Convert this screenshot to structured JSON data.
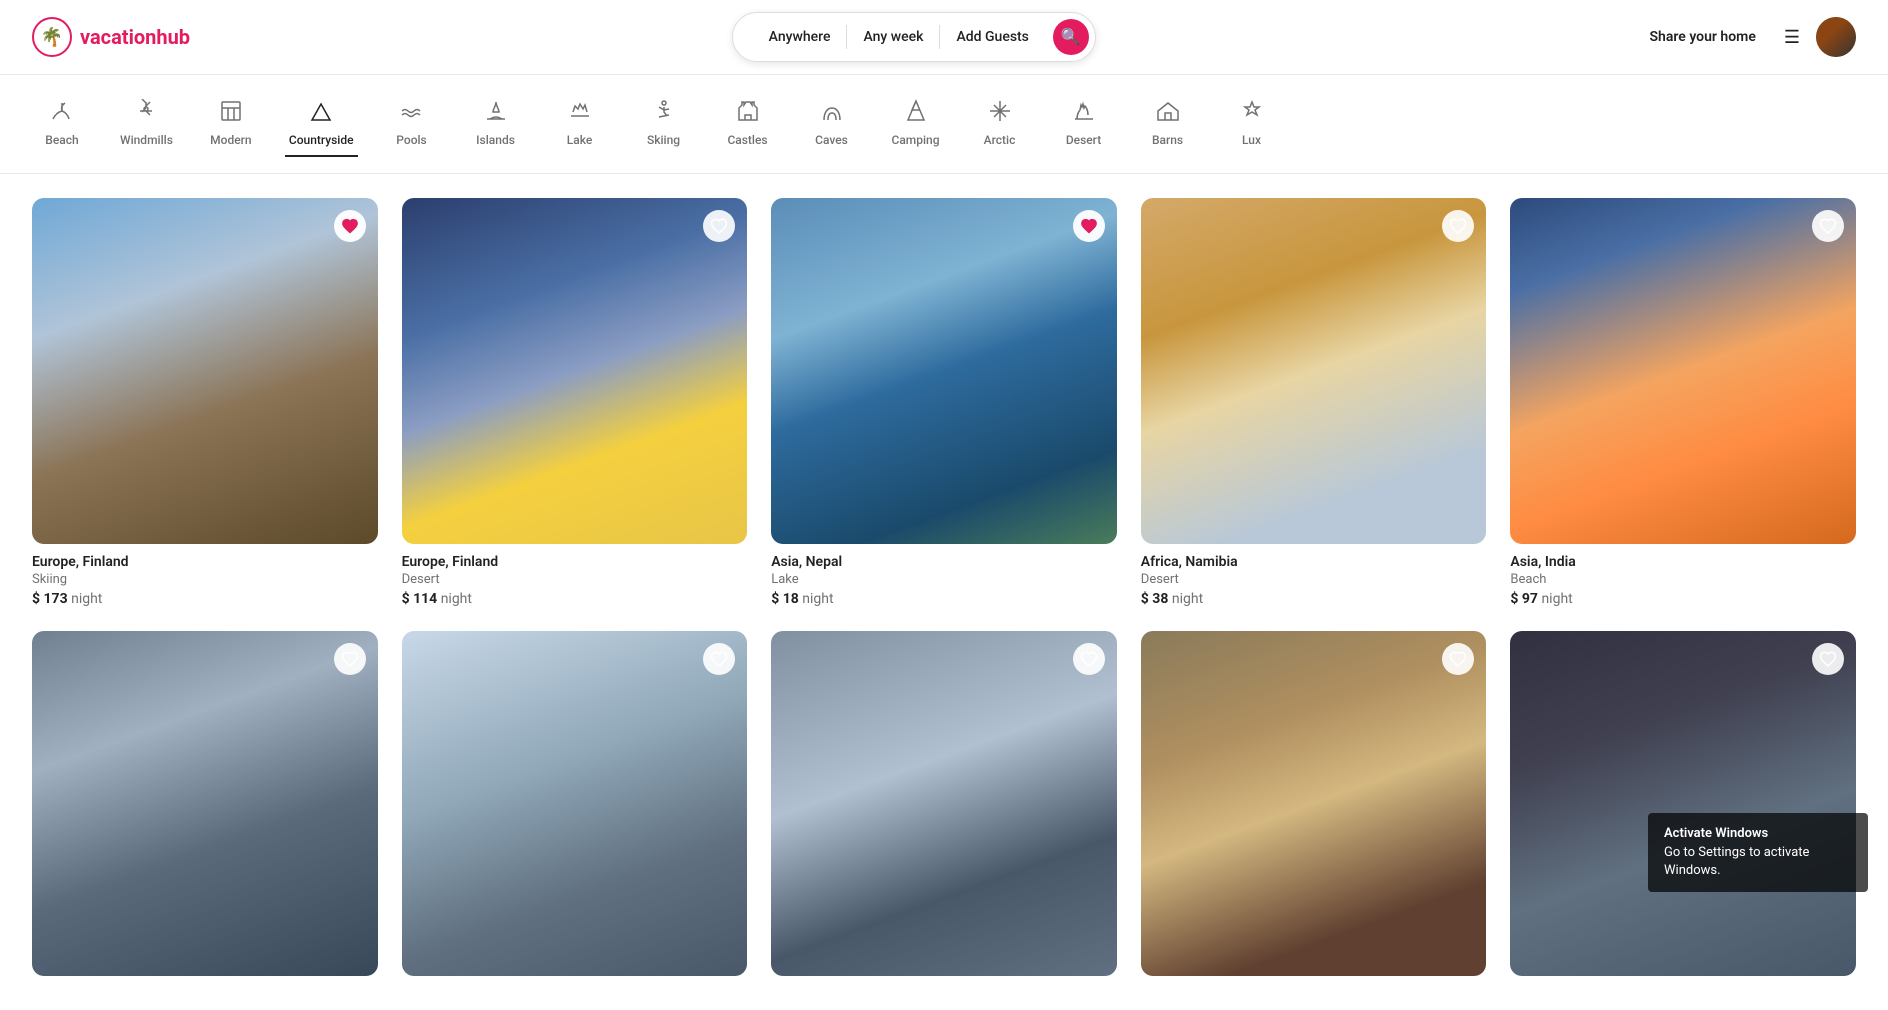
{
  "header": {
    "logo_text": "vacationhub",
    "search": {
      "location_placeholder": "Anywhere",
      "week_placeholder": "Any week",
      "guests_placeholder": "Add Guests"
    },
    "share_home_label": "Share your home"
  },
  "categories": [
    {
      "id": "beach",
      "label": "Beach",
      "icon": "🏖"
    },
    {
      "id": "windmills",
      "label": "Windmills",
      "icon": "🏚"
    },
    {
      "id": "modern",
      "label": "Modern",
      "icon": "🏢"
    },
    {
      "id": "countryside",
      "label": "Countryside",
      "icon": "⛰"
    },
    {
      "id": "pools",
      "label": "Pools",
      "icon": "🌊"
    },
    {
      "id": "islands",
      "label": "Islands",
      "icon": "🏝"
    },
    {
      "id": "lake",
      "label": "Lake",
      "icon": "🚣"
    },
    {
      "id": "skiing",
      "label": "Skiing",
      "icon": "⛷"
    },
    {
      "id": "castles",
      "label": "Castles",
      "icon": "🏰"
    },
    {
      "id": "caves",
      "label": "Caves",
      "icon": "🧗"
    },
    {
      "id": "camping",
      "label": "Camping",
      "icon": "🌲"
    },
    {
      "id": "arctic",
      "label": "Arctic",
      "icon": "❄"
    },
    {
      "id": "desert",
      "label": "Desert",
      "icon": "🗿"
    },
    {
      "id": "barns",
      "label": "Barns",
      "icon": "🏚"
    },
    {
      "id": "lux",
      "label": "Lux",
      "icon": "💎"
    }
  ],
  "listings_row1": [
    {
      "id": 1,
      "location": "Europe, Finland",
      "type": "Skiing",
      "price": "$ 173",
      "per_night": "night",
      "liked": true,
      "img_class": "img-finland-1"
    },
    {
      "id": 2,
      "location": "Europe, Finland",
      "type": "Desert",
      "price": "$ 114",
      "per_night": "night",
      "liked": false,
      "img_class": "img-finland-2"
    },
    {
      "id": 3,
      "location": "Asia, Nepal",
      "type": "Lake",
      "price": "$ 18",
      "per_night": "night",
      "liked": true,
      "img_class": "img-nepal"
    },
    {
      "id": 4,
      "location": "Africa, Namibia",
      "type": "Desert",
      "price": "$ 38",
      "per_night": "night",
      "liked": false,
      "img_class": "img-namibia"
    },
    {
      "id": 5,
      "location": "Asia, India",
      "type": "Beach",
      "price": "$ 97",
      "per_night": "night",
      "liked": false,
      "img_class": "img-india"
    }
  ],
  "listings_row2": [
    {
      "id": 6,
      "location": "",
      "type": "",
      "price": "",
      "per_night": "",
      "liked": false,
      "img_class": "img-row2-1"
    },
    {
      "id": 7,
      "location": "",
      "type": "",
      "price": "",
      "per_night": "",
      "liked": false,
      "img_class": "img-row2-2"
    },
    {
      "id": 8,
      "location": "",
      "type": "",
      "price": "",
      "per_night": "",
      "liked": false,
      "img_class": "img-row2-3"
    },
    {
      "id": 9,
      "location": "",
      "type": "",
      "price": "",
      "per_night": "",
      "liked": false,
      "img_class": "img-row2-4"
    },
    {
      "id": 10,
      "location": "",
      "type": "",
      "price": "",
      "per_night": "",
      "liked": false,
      "img_class": "img-row2-5"
    }
  ],
  "windows_watermark": {
    "line1": "Activate Windows",
    "line2": "Go to Settings to activate Windows."
  }
}
